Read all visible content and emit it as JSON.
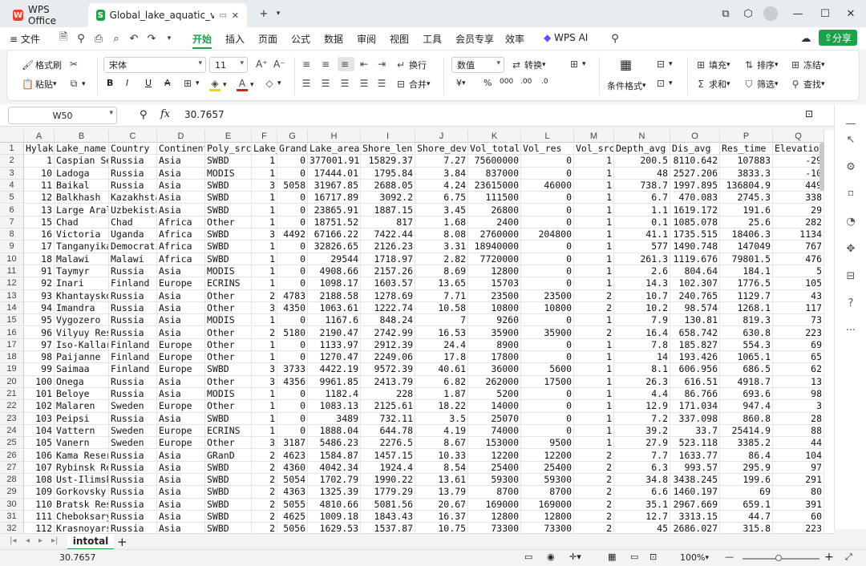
{
  "tabs": [
    {
      "label": "WPS Office",
      "icon": "wps-logo-icon"
    },
    {
      "label": "Global_lake_aquatic_vegetat",
      "icon": "spreadsheet-logo-icon"
    }
  ],
  "menu": {
    "file": "文件",
    "items": [
      "开始",
      "插入",
      "页面",
      "公式",
      "数据",
      "审阅",
      "视图",
      "工具",
      "会员专享",
      "效率"
    ],
    "ai": "WPS AI",
    "share": "分享"
  },
  "ribbon": {
    "format_painter": "格式刷",
    "paste": "粘贴",
    "font_name": "宋体",
    "font_size": "11",
    "wrap": "换行",
    "merge": "合并",
    "number_format": "数值",
    "convert": "转换",
    "conditional_format": "条件格式",
    "fill": "填充",
    "sort": "排序",
    "freeze": "冻结",
    "sum": "求和",
    "filter": "筛选",
    "find": "查找",
    "yuan": "¥",
    "percent": "%",
    "thousands": "000",
    "dec_inc": ".00",
    "dec_dec": ".0"
  },
  "formula": {
    "name_box": "W50",
    "fx": "fx",
    "value": "30.7657"
  },
  "columns": [
    "A",
    "B",
    "C",
    "D",
    "E",
    "F",
    "G",
    "H",
    "I",
    "J",
    "K",
    "L",
    "M",
    "N",
    "O",
    "P",
    "Q"
  ],
  "header_row": [
    "Hylak",
    "Lake_name",
    "Country",
    "Continent",
    "Poly_src",
    "Lake_",
    "Grand_",
    "Lake_area",
    "Shore_len",
    "Shore_dev",
    "Vol_total",
    "Vol_res",
    "Vol_src",
    "Depth_avg",
    "Dis_avg",
    "Res_time",
    "Elevation"
  ],
  "rows": [
    [
      "1",
      "Caspian Se",
      "Russia",
      "Asia",
      "SWBD",
      "1",
      "0",
      "377001.91",
      "15829.37",
      "7.27",
      "75600000",
      "0",
      "1",
      "200.5",
      "8110.642",
      "107883",
      "-29"
    ],
    [
      "10",
      "Ladoga",
      "Russia",
      "Asia",
      "MODIS",
      "1",
      "0",
      "17444.01",
      "1795.84",
      "3.84",
      "837000",
      "0",
      "1",
      "48",
      "2527.206",
      "3833.3",
      "-10"
    ],
    [
      "11",
      "Baikal",
      "Russia",
      "Asia",
      "SWBD",
      "3",
      "5058",
      "31967.85",
      "2688.05",
      "4.24",
      "23615000",
      "46000",
      "1",
      "738.7",
      "1997.895",
      "136804.9",
      "449"
    ],
    [
      "12",
      "Balkhash",
      "Kazakhsta",
      "Asia",
      "SWBD",
      "1",
      "0",
      "16717.89",
      "3092.2",
      "6.75",
      "111500",
      "0",
      "1",
      "6.7",
      "470.083",
      "2745.3",
      "338"
    ],
    [
      "13",
      "Large Aral",
      "Uzbekista",
      "Asia",
      "SWBD",
      "1",
      "0",
      "23865.91",
      "1887.15",
      "3.45",
      "26800",
      "0",
      "1",
      "1.1",
      "1619.172",
      "191.6",
      "29"
    ],
    [
      "15",
      "Chad",
      "Chad",
      "Africa",
      "Other",
      "1",
      "0",
      "18751.52",
      "817",
      "1.68",
      "2400",
      "0",
      "1",
      "0.1",
      "1085.078",
      "25.6",
      "282"
    ],
    [
      "16",
      "Victoria",
      "Uganda",
      "Africa",
      "SWBD",
      "3",
      "4492",
      "67166.22",
      "7422.44",
      "8.08",
      "2760000",
      "204800",
      "1",
      "41.1",
      "1735.515",
      "18406.3",
      "1134"
    ],
    [
      "17",
      "Tanganyika",
      "Democrati",
      "Africa",
      "SWBD",
      "1",
      "0",
      "32826.65",
      "2126.23",
      "3.31",
      "18940000",
      "0",
      "1",
      "577",
      "1490.748",
      "147049",
      "767"
    ],
    [
      "18",
      "Malawi",
      "Malawi",
      "Africa",
      "SWBD",
      "1",
      "0",
      "29544",
      "1718.97",
      "2.82",
      "7720000",
      "0",
      "1",
      "261.3",
      "1119.676",
      "79801.5",
      "476"
    ],
    [
      "91",
      "Taymyr",
      "Russia",
      "Asia",
      "MODIS",
      "1",
      "0",
      "4908.66",
      "2157.26",
      "8.69",
      "12800",
      "0",
      "1",
      "2.6",
      "804.64",
      "184.1",
      "5"
    ],
    [
      "92",
      "Inari",
      "Finland",
      "Europe",
      "ECRINS",
      "1",
      "0",
      "1098.17",
      "1603.57",
      "13.65",
      "15703",
      "0",
      "1",
      "14.3",
      "102.307",
      "1776.5",
      "105"
    ],
    [
      "93",
      "Khantaysko",
      "Russia",
      "Asia",
      "Other",
      "2",
      "4783",
      "2188.58",
      "1278.69",
      "7.71",
      "23500",
      "23500",
      "2",
      "10.7",
      "240.765",
      "1129.7",
      "43"
    ],
    [
      "94",
      "Imandra",
      "Russia",
      "Asia",
      "Other",
      "3",
      "4350",
      "1063.61",
      "1222.74",
      "10.58",
      "10800",
      "10800",
      "2",
      "10.2",
      "98.574",
      "1268.1",
      "117"
    ],
    [
      "95",
      "Vygozero",
      "Russia",
      "Asia",
      "MODIS",
      "1",
      "0",
      "1167.6",
      "848.24",
      "7",
      "9260",
      "0",
      "1",
      "7.9",
      "130.81",
      "819.3",
      "73"
    ],
    [
      "96",
      "Vilyuy Res",
      "Russia",
      "Asia",
      "Other",
      "2",
      "5180",
      "2190.47",
      "2742.99",
      "16.53",
      "35900",
      "35900",
      "2",
      "16.4",
      "658.742",
      "630.8",
      "223"
    ],
    [
      "97",
      "Iso-Kallar",
      "Finland",
      "Europe",
      "Other",
      "1",
      "0",
      "1133.97",
      "2912.39",
      "24.4",
      "8900",
      "0",
      "1",
      "7.8",
      "185.827",
      "554.3",
      "69"
    ],
    [
      "98",
      "Paijanne",
      "Finland",
      "Europe",
      "Other",
      "1",
      "0",
      "1270.47",
      "2249.06",
      "17.8",
      "17800",
      "0",
      "1",
      "14",
      "193.426",
      "1065.1",
      "65"
    ],
    [
      "99",
      "Saimaa",
      "Finland",
      "Europe",
      "SWBD",
      "3",
      "3733",
      "4422.19",
      "9572.39",
      "40.61",
      "36000",
      "5600",
      "1",
      "8.1",
      "606.956",
      "686.5",
      "62"
    ],
    [
      "100",
      "Onega",
      "Russia",
      "Asia",
      "Other",
      "3",
      "4356",
      "9961.85",
      "2413.79",
      "6.82",
      "262000",
      "17500",
      "1",
      "26.3",
      "616.51",
      "4918.7",
      "13"
    ],
    [
      "101",
      "Beloye",
      "Russia",
      "Asia",
      "MODIS",
      "1",
      "0",
      "1182.4",
      "228",
      "1.87",
      "5200",
      "0",
      "1",
      "4.4",
      "86.766",
      "693.6",
      "98"
    ],
    [
      "102",
      "Malaren",
      "Sweden",
      "Europe",
      "Other",
      "1",
      "0",
      "1083.13",
      "2125.61",
      "18.22",
      "14000",
      "0",
      "1",
      "12.9",
      "171.034",
      "947.4",
      "3"
    ],
    [
      "103",
      "Peipsi",
      "Russia",
      "Asia",
      "SWBD",
      "1",
      "0",
      "3489",
      "732.11",
      "3.5",
      "25070",
      "0",
      "1",
      "7.2",
      "337.098",
      "860.8",
      "28"
    ],
    [
      "104",
      "Vattern",
      "Sweden",
      "Europe",
      "ECRINS",
      "1",
      "0",
      "1888.04",
      "644.78",
      "4.19",
      "74000",
      "0",
      "1",
      "39.2",
      "33.7",
      "25414.9",
      "88"
    ],
    [
      "105",
      "Vanern",
      "Sweden",
      "Europe",
      "Other",
      "3",
      "3187",
      "5486.23",
      "2276.5",
      "8.67",
      "153000",
      "9500",
      "1",
      "27.9",
      "523.118",
      "3385.2",
      "44"
    ],
    [
      "106",
      "Kama Reser",
      "Russia",
      "Asia",
      "GRanD",
      "2",
      "4623",
      "1584.87",
      "1457.15",
      "10.33",
      "12200",
      "12200",
      "2",
      "7.7",
      "1633.77",
      "86.4",
      "104"
    ],
    [
      "107",
      "Rybinsk Re",
      "Russia",
      "Asia",
      "SWBD",
      "2",
      "4360",
      "4042.34",
      "1924.4",
      "8.54",
      "25400",
      "25400",
      "2",
      "6.3",
      "993.57",
      "295.9",
      "97"
    ],
    [
      "108",
      "Ust-Ilimsk",
      "Russia",
      "Asia",
      "SWBD",
      "2",
      "5054",
      "1702.79",
      "1990.22",
      "13.61",
      "59300",
      "59300",
      "2",
      "34.8",
      "3438.245",
      "199.6",
      "291"
    ],
    [
      "109",
      "Gorkovsky",
      "Russia",
      "Asia",
      "SWBD",
      "2",
      "4363",
      "1325.39",
      "1779.29",
      "13.79",
      "8700",
      "8700",
      "2",
      "6.6",
      "1460.197",
      "69",
      "80"
    ],
    [
      "110",
      "Bratsk Res",
      "Russia",
      "Asia",
      "SWBD",
      "2",
      "5055",
      "4810.66",
      "5081.56",
      "20.67",
      "169000",
      "169000",
      "2",
      "35.1",
      "2967.669",
      "659.1",
      "391"
    ],
    [
      "111",
      "Cheboksary",
      "Russia",
      "Asia",
      "SWBD",
      "2",
      "4625",
      "1009.18",
      "1843.43",
      "16.37",
      "12800",
      "12800",
      "2",
      "12.7",
      "3313.15",
      "44.7",
      "60"
    ],
    [
      "112",
      "Krasnoyars",
      "Russia",
      "Asia",
      "SWBD",
      "2",
      "5056",
      "1629.53",
      "1537.87",
      "10.75",
      "73300",
      "73300",
      "2",
      "45",
      "2686.027",
      "315.8",
      "223"
    ]
  ],
  "sheet": {
    "name": "intotal",
    "add": "+"
  },
  "status": {
    "value": "30.7657",
    "zoom": "100%"
  }
}
